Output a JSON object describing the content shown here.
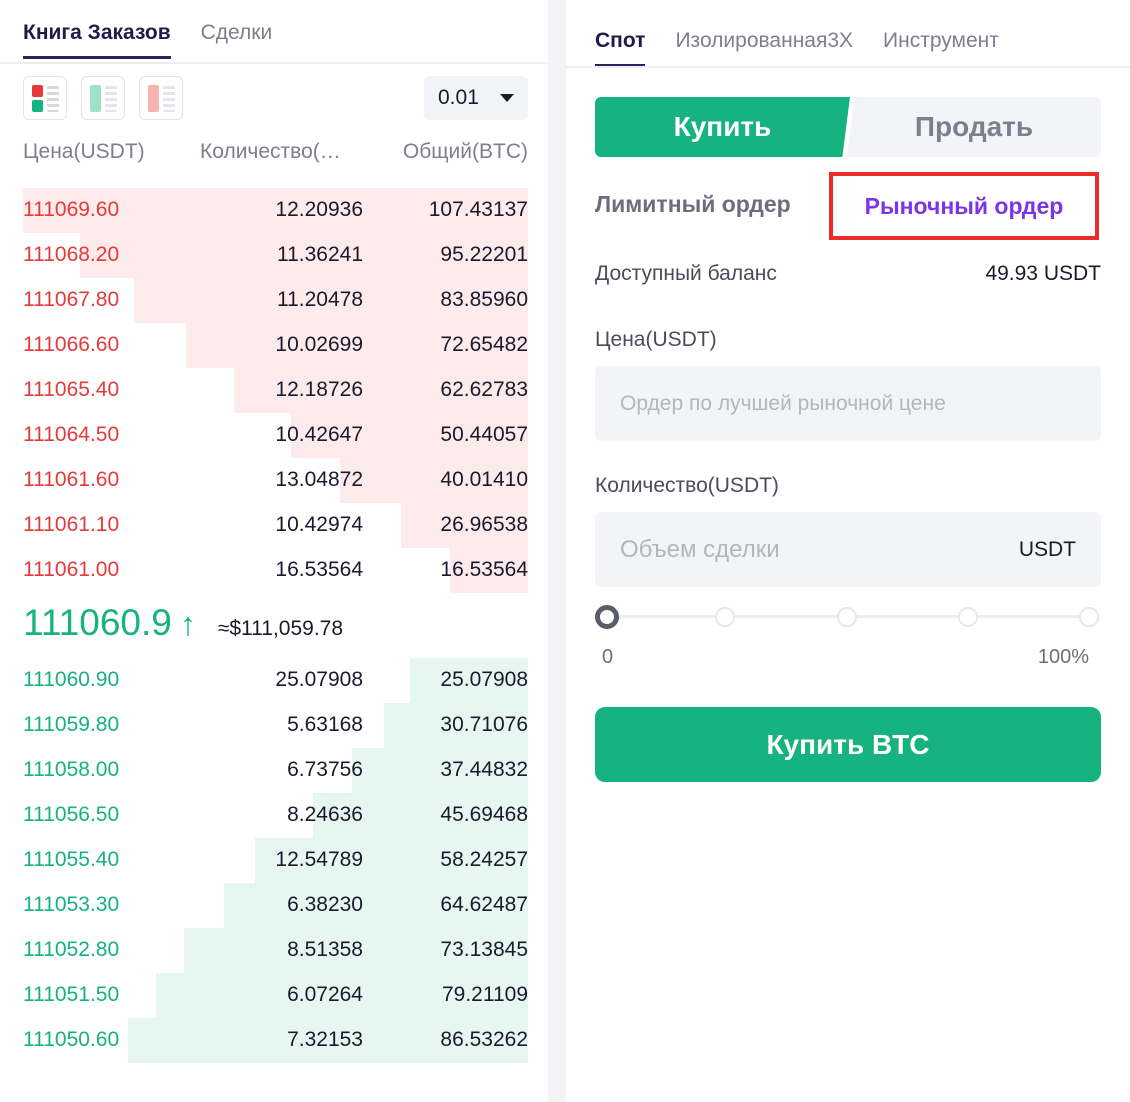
{
  "orderbook": {
    "tabs": [
      {
        "label": "Книга Заказов",
        "active": true
      },
      {
        "label": "Сделки",
        "active": false
      }
    ],
    "view_icons": [
      "orderbook-both-icon",
      "orderbook-bids-icon",
      "orderbook-asks-icon"
    ],
    "precision": "0.01",
    "columns": {
      "price": "Цена(USDT)",
      "quantity": "Количество(…",
      "total": "Общий(BTC)"
    },
    "asks": [
      {
        "price": "111069.60",
        "qty": "12.20936",
        "total": "107.43137",
        "depth": 1.0
      },
      {
        "price": "111068.20",
        "qty": "11.36241",
        "total": "95.22201",
        "depth": 0.8871
      },
      {
        "price": "111067.80",
        "qty": "11.20478",
        "total": "83.85960",
        "depth": 0.7812
      },
      {
        "price": "111066.60",
        "qty": "10.02699",
        "total": "72.65482",
        "depth": 0.6772
      },
      {
        "price": "111065.40",
        "qty": "12.18726",
        "total": "62.62783",
        "depth": 0.5822
      },
      {
        "price": "111064.50",
        "qty": "10.42647",
        "total": "50.44057",
        "depth": 0.4693
      },
      {
        "price": "111061.60",
        "qty": "13.04872",
        "total": "40.01410",
        "depth": 0.3723
      },
      {
        "price": "111061.10",
        "qty": "10.42974",
        "total": "26.96538",
        "depth": 0.2515
      },
      {
        "price": "111061.00",
        "qty": "16.53564",
        "total": "16.53564",
        "depth": 0.1544
      }
    ],
    "last_price": "111060.9",
    "last_price_direction": "up",
    "last_price_usd": "≈$111,059.78",
    "bids": [
      {
        "price": "111060.90",
        "qty": "25.07908",
        "total": "25.07908",
        "depth": 0.2337
      },
      {
        "price": "111059.80",
        "qty": "5.63168",
        "total": "30.71076",
        "depth": 0.2851
      },
      {
        "price": "111058.00",
        "qty": "6.73756",
        "total": "37.44832",
        "depth": 0.3485
      },
      {
        "price": "111056.50",
        "qty": "8.24636",
        "total": "45.69468",
        "depth": 0.4257
      },
      {
        "price": "111055.40",
        "qty": "12.54789",
        "total": "58.24257",
        "depth": 0.5406
      },
      {
        "price": "111053.30",
        "qty": "6.38230",
        "total": "64.62487",
        "depth": 0.602
      },
      {
        "price": "111052.80",
        "qty": "8.51358",
        "total": "73.13845",
        "depth": 0.6812
      },
      {
        "price": "111051.50",
        "qty": "6.07264",
        "total": "79.21109",
        "depth": 0.7366
      },
      {
        "price": "111050.60",
        "qty": "7.32153",
        "total": "86.53262",
        "depth": 0.792
      }
    ]
  },
  "trade": {
    "tabs": [
      {
        "label": "Спот",
        "active": true
      },
      {
        "label": "Изолированная3X",
        "active": false
      },
      {
        "label": "Инструмент",
        "active": false
      }
    ],
    "side_buy": "Купить",
    "side_sell": "Продать",
    "order_type_limit": "Лимитный ордер",
    "order_type_market": "Рыночный ордер",
    "balance_label": "Доступный баланс",
    "balance_value": "49.93 USDT",
    "price_label": "Цена(USDT)",
    "price_placeholder": "Ордер по лучшей рыночной цене",
    "qty_label": "Количество(USDT)",
    "qty_placeholder": "Объем сделки",
    "qty_unit": "USDT",
    "slider_value": 0,
    "slider_min_label": "0",
    "slider_max_label": "100%",
    "submit_label": "Купить BTC"
  },
  "colors": {
    "buy": "#16b27f",
    "sell": "#e63a3a",
    "highlight_border": "#ee2a2a",
    "active_order_type": "#7b35e8"
  }
}
